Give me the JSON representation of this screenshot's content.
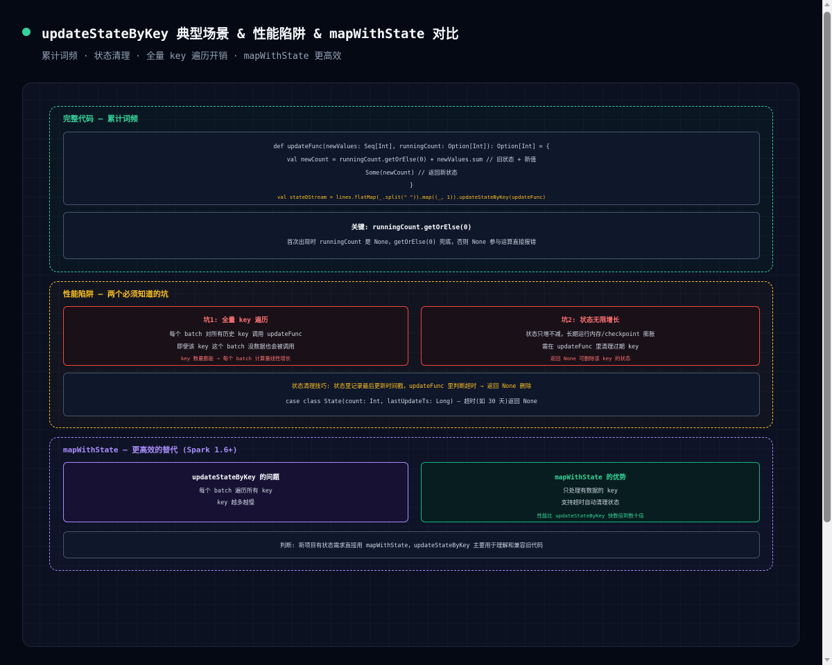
{
  "header": {
    "title": "updateStateByKey 典型场景 & 性能陷阱 & mapWithState 对比",
    "subtitle": "累计词频 · 状态清理 · 全量 key 遍历开销 · mapWithState 更高效"
  },
  "code_section": {
    "title": "完整代码 — 累计词频",
    "code_lines": [
      "def updateFunc(newValues: Seq[Int], runningCount: Option[Int]): Option[Int] = {",
      "val newCount = runningCount.getOrElse(0) + newValues.sum // 旧状态 + 新值",
      "Some(newCount) // 返回新状态",
      "}"
    ],
    "highlight": "val stateDStream = lines.flatMap(_.split(\" \")).map((_, 1)).updateStateByKey(updateFunc)",
    "key_title": "关键: runningCount.getOrElse(0)",
    "key_text": "首次出现时 runningCount 是 None，getOrElse(0) 兜底，否则 None 参与运算直接报错"
  },
  "pitfalls": {
    "title": "性能陷阱 — 两个必须知道的坑",
    "pit1": {
      "title": "坑1: 全量 key 遍历",
      "lines": [
        "每个 batch 对所有历史 key 调用 updateFunc",
        "即使该 key 这个 batch 没数据也会被调用"
      ],
      "note": "key 数量膨胀 → 每个 batch 计算量线性增长"
    },
    "pit2": {
      "title": "坑2: 状态无限增长",
      "lines": [
        "状态只增不减，长期运行内存/checkpoint 膨胀",
        "需在 updateFunc 里清理过期 key"
      ],
      "note": "返回 None 可删除该 key 的状态"
    },
    "tip_title": "状态清理技巧: 状态里记录最后更新时间戳，updateFunc 里判断超时 → 返回 None 删除",
    "tip_text": "case class State(count: Int, lastUpdateTs: Long) — 超时(如 30 天)返回 None"
  },
  "mapwithstate": {
    "title": "mapWithState — 更高效的替代 (Spark 1.6+)",
    "left": {
      "title": "updateStateByKey 的问题",
      "lines": [
        "每个 batch 遍历所有 key",
        "key 越多越慢"
      ]
    },
    "right": {
      "title": "mapWithState 的优势",
      "lines": [
        "只处理有数据的 key",
        "支持超时自动清理状态"
      ],
      "note": "性能比 updateStateByKey 快数倍到数十倍"
    },
    "verdict": "判断: 新项目有状态需求直接用 mapWithState，updateStateByKey 主要用于理解和兼容旧代码"
  }
}
